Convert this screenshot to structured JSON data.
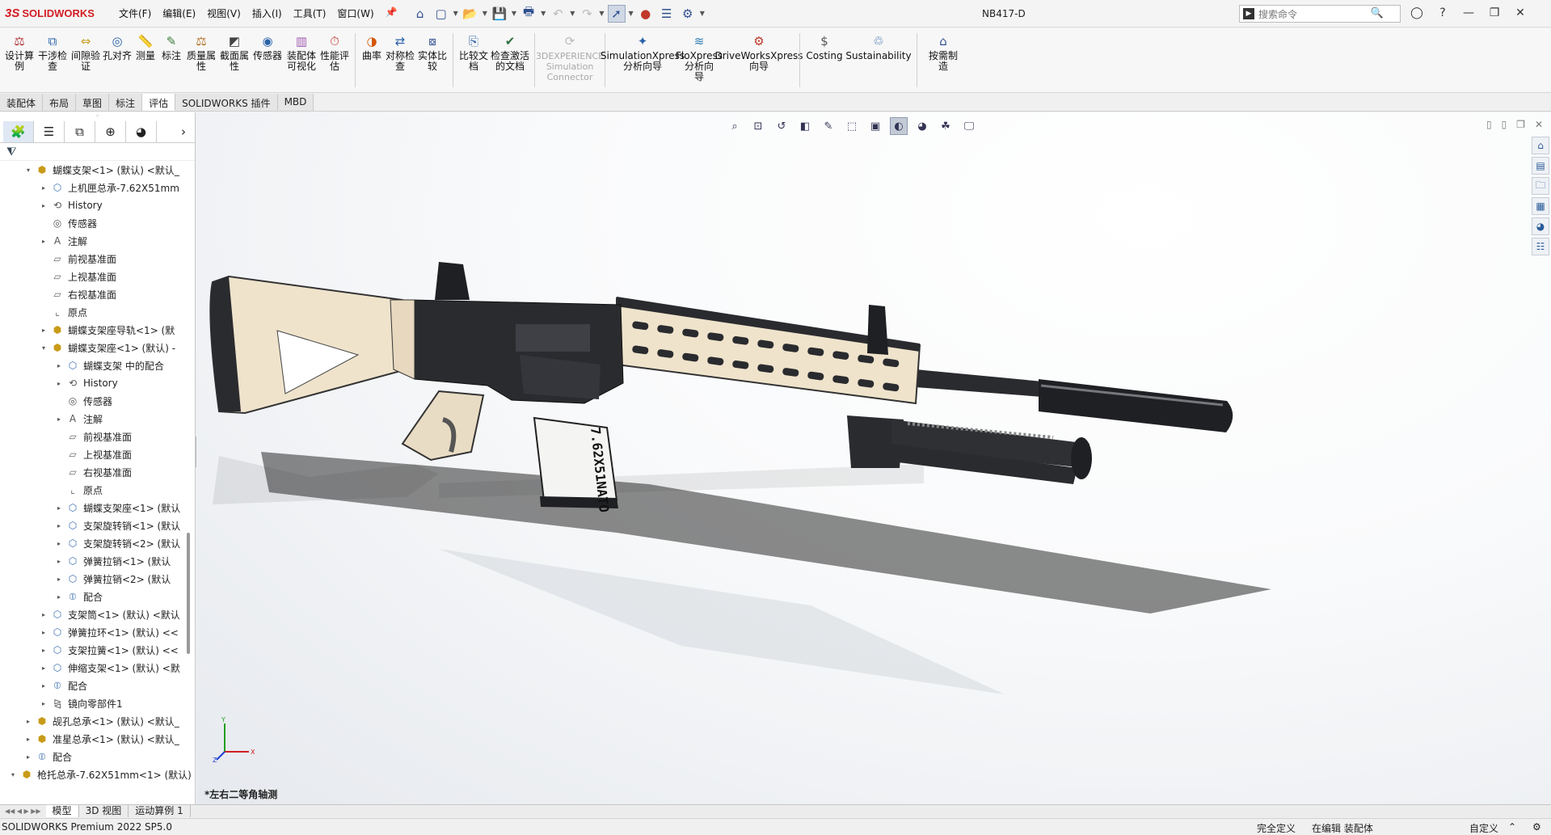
{
  "app": {
    "brand": "SOLIDWORKS",
    "brand_prefix": "3S",
    "doc_title": "NB417-D"
  },
  "menus": [
    "文件(F)",
    "编辑(E)",
    "视图(V)",
    "插入(I)",
    "工具(T)",
    "窗口(W)"
  ],
  "search": {
    "placeholder": "搜索命令"
  },
  "commands": [
    {
      "label": "设计算\n例",
      "icon": "design-study-icon"
    },
    {
      "label": "干涉检\n查",
      "icon": "interference-check-icon"
    },
    {
      "label": "间隙验\n证",
      "icon": "clearance-verify-icon"
    },
    {
      "label": "孔对齐",
      "icon": "hole-alignment-icon"
    },
    {
      "label": "测量",
      "icon": "measure-icon"
    },
    {
      "label": "标注",
      "icon": "markup-icon"
    },
    {
      "label": "质量属\n性",
      "icon": "mass-properties-icon"
    },
    {
      "label": "截面属\n性",
      "icon": "section-properties-icon"
    },
    {
      "label": "传感器",
      "icon": "sensor-icon"
    },
    {
      "label": "装配体\n可视化",
      "icon": "assembly-visualization-icon"
    },
    {
      "label": "性能评\n估",
      "icon": "performance-eval-icon"
    },
    {
      "label": "曲率",
      "icon": "curvature-icon"
    },
    {
      "label": "对称检\n查",
      "icon": "symmetry-check-icon"
    },
    {
      "label": "实体比\n较",
      "icon": "body-compare-icon"
    },
    {
      "label": "比较文\n档",
      "icon": "compare-docs-icon"
    },
    {
      "label": "检查激活\n的文档",
      "icon": "check-doc-icon"
    },
    {
      "label": "3DEXPERIENCE\nSimulation\nConnector",
      "icon": "simulation-connector-icon",
      "disabled": true
    },
    {
      "label": "SimulationXpress\n分析向导",
      "icon": "simulationxpress-icon"
    },
    {
      "label": "FloXpress\n分析向\n导",
      "icon": "floxpress-icon"
    },
    {
      "label": "DriveWorksXpress\n向导",
      "icon": "driveworksxpress-icon"
    },
    {
      "label": "Costing",
      "icon": "costing-icon"
    },
    {
      "label": "Sustainability",
      "icon": "sustainability-icon"
    },
    {
      "label": "按需制\n造",
      "icon": "on-demand-manufacturing-icon"
    }
  ],
  "ribbon_tabs": [
    "装配体",
    "布局",
    "草图",
    "标注",
    "评估",
    "SOLIDWORKS 插件",
    "MBD"
  ],
  "active_ribbon_tab": "评估",
  "tree": [
    {
      "indent": 1,
      "exp": "open",
      "icon": "assembly",
      "label": "蝴蝶支架<1> (默认) <默认_"
    },
    {
      "indent": 2,
      "exp": "closed",
      "icon": "part",
      "label": "上机匣总承-7.62X51mm"
    },
    {
      "indent": 2,
      "exp": "closed",
      "icon": "history",
      "label": "History"
    },
    {
      "indent": 2,
      "exp": "none",
      "icon": "sensor",
      "label": "传感器"
    },
    {
      "indent": 2,
      "exp": "closed",
      "icon": "annotation",
      "label": "注解"
    },
    {
      "indent": 2,
      "exp": "none",
      "icon": "plane",
      "label": "前视基准面"
    },
    {
      "indent": 2,
      "exp": "none",
      "icon": "plane",
      "label": "上视基准面"
    },
    {
      "indent": 2,
      "exp": "none",
      "icon": "plane",
      "label": "右视基准面"
    },
    {
      "indent": 2,
      "exp": "none",
      "icon": "origin",
      "label": "原点"
    },
    {
      "indent": 2,
      "exp": "closed",
      "icon": "assembly",
      "label": "蝴蝶支架座导轨<1> (默"
    },
    {
      "indent": 2,
      "exp": "open",
      "icon": "assembly",
      "label": "蝴蝶支架座<1> (默认) -"
    },
    {
      "indent": 3,
      "exp": "closed",
      "icon": "part",
      "label": "蝴蝶支架 中的配合"
    },
    {
      "indent": 3,
      "exp": "closed",
      "icon": "history",
      "label": "History"
    },
    {
      "indent": 3,
      "exp": "none",
      "icon": "sensor",
      "label": "传感器"
    },
    {
      "indent": 3,
      "exp": "closed",
      "icon": "annotation",
      "label": "注解"
    },
    {
      "indent": 3,
      "exp": "none",
      "icon": "plane",
      "label": "前视基准面"
    },
    {
      "indent": 3,
      "exp": "none",
      "icon": "plane",
      "label": "上视基准面"
    },
    {
      "indent": 3,
      "exp": "none",
      "icon": "plane",
      "label": "右视基准面"
    },
    {
      "indent": 3,
      "exp": "none",
      "icon": "origin",
      "label": "原点"
    },
    {
      "indent": 3,
      "exp": "closed",
      "icon": "part",
      "label": "蝴蝶支架座<1> (默认"
    },
    {
      "indent": 3,
      "exp": "closed",
      "icon": "part",
      "label": "支架旋转销<1> (默认"
    },
    {
      "indent": 3,
      "exp": "closed",
      "icon": "part",
      "label": "支架旋转销<2> (默认"
    },
    {
      "indent": 3,
      "exp": "closed",
      "icon": "part",
      "label": "弹簧拉销<1> (默认"
    },
    {
      "indent": 3,
      "exp": "closed",
      "icon": "part",
      "label": "弹簧拉销<2> (默认"
    },
    {
      "indent": 3,
      "exp": "closed",
      "icon": "mates",
      "label": "配合"
    },
    {
      "indent": 2,
      "exp": "closed",
      "icon": "part",
      "label": "支架筒<1> (默认) <默认"
    },
    {
      "indent": 2,
      "exp": "closed",
      "icon": "part",
      "label": "弹簧拉环<1> (默认) <<"
    },
    {
      "indent": 2,
      "exp": "closed",
      "icon": "part",
      "label": "支架拉簧<1> (默认) <<"
    },
    {
      "indent": 2,
      "exp": "closed",
      "icon": "part",
      "label": "伸缩支架<1> (默认) <默"
    },
    {
      "indent": 2,
      "exp": "closed",
      "icon": "mates",
      "label": "配合"
    },
    {
      "indent": 2,
      "exp": "closed",
      "icon": "mirror",
      "label": "镜向零部件1"
    },
    {
      "indent": 1,
      "exp": "closed",
      "icon": "assembly",
      "label": "觇孔总承<1> (默认) <默认_"
    },
    {
      "indent": 1,
      "exp": "closed",
      "icon": "assembly",
      "label": "准星总承<1> (默认) <默认_"
    },
    {
      "indent": 1,
      "exp": "closed",
      "icon": "mates",
      "label": "配合"
    },
    {
      "indent": 0,
      "exp": "open",
      "icon": "assembly",
      "label": "枪托总承-7.62X51mm<1> (默认)"
    }
  ],
  "viewport": {
    "view_name": "*左右二等角轴测"
  },
  "magazine_text": "7.62X51NATO",
  "bottom_tabs": [
    "模型",
    "3D 视图",
    "运动算例 1"
  ],
  "status": {
    "product": "SOLIDWORKS Premium 2022 SP5.0",
    "defined": "完全定义",
    "editing": "在编辑 装配体",
    "custom": "自定义"
  },
  "colors": {
    "brand": "#d31d24",
    "accent": "#2f4f8f",
    "tan": "#efe3cc",
    "metal": "#2a2b2e"
  }
}
